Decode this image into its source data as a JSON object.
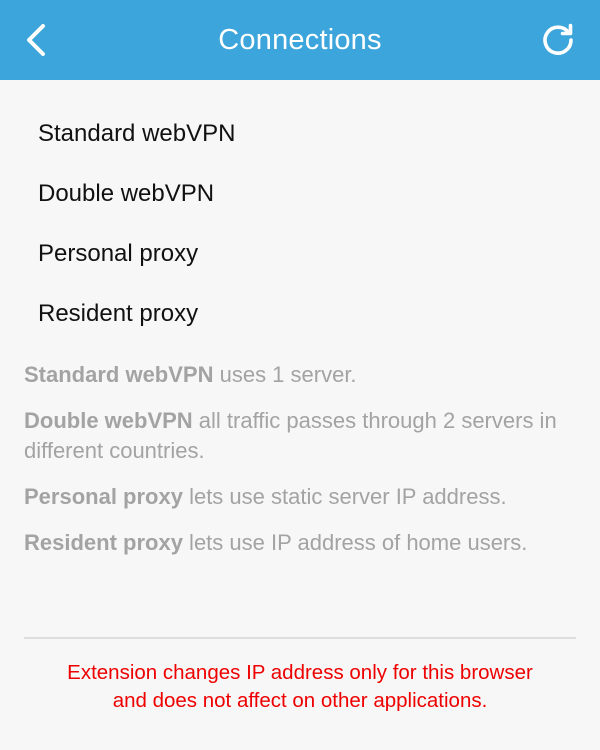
{
  "header": {
    "title": "Connections",
    "back_icon": "chevron-left-icon",
    "refresh_icon": "refresh-icon",
    "color": "#3ba5dc"
  },
  "menu": {
    "items": [
      {
        "label": "Standard webVPN"
      },
      {
        "label": "Double webVPN"
      },
      {
        "label": "Personal proxy"
      },
      {
        "label": "Resident proxy"
      }
    ]
  },
  "descriptions": [
    {
      "term": "Standard webVPN",
      "text": " uses 1 server."
    },
    {
      "term": "Double webVPN",
      "text": " all traffic passes through 2 servers in different countries."
    },
    {
      "term": "Personal proxy",
      "text": " lets use static server IP address."
    },
    {
      "term": "Resident proxy",
      "text": " lets use IP address of home users."
    }
  ],
  "notice": {
    "line1": "Extension changes IP address only for this browser",
    "line2": "and does not affect on other applications.",
    "color": "#ee0000"
  }
}
